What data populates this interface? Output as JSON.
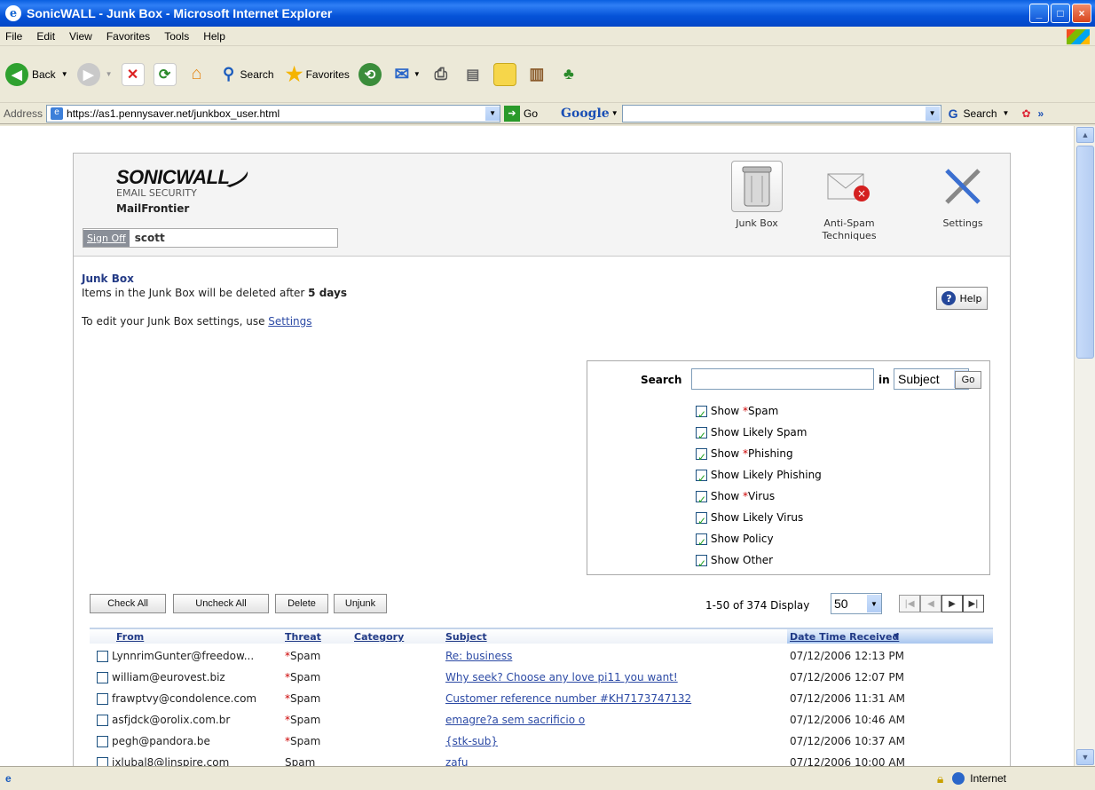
{
  "window": {
    "title": "SonicWALL - Junk Box - Microsoft Internet Explorer",
    "min": "_",
    "max": "□",
    "close": "×"
  },
  "menu": [
    "File",
    "Edit",
    "View",
    "Favorites",
    "Tools",
    "Help"
  ],
  "toolbar": {
    "back": "Back",
    "search": "Search",
    "favorites": "Favorites"
  },
  "address": {
    "label": "Address",
    "url": "https://as1.pennysaver.net/junkbox_user.html",
    "go": "Go",
    "google": "Google",
    "google_search": "Search"
  },
  "header": {
    "brand": "SONICWALL",
    "brand_sub": "EMAIL SECURITY",
    "brand_sub2": "MailFrontier",
    "signoff": "Sign Off",
    "user": "scott",
    "nav": [
      {
        "label": "Junk Box"
      },
      {
        "label": "Anti-Spam Techniques"
      },
      {
        "label": "Settings"
      }
    ]
  },
  "junkbox": {
    "title": "Junk Box",
    "desc_pre": "Items in the Junk Box will be deleted after ",
    "days": "5 days",
    "edit_pre": "To edit your Junk Box settings, use ",
    "edit_link": "Settings",
    "help": "Help"
  },
  "search": {
    "label": "Search",
    "in": "in",
    "field": "Subject",
    "go": "Go",
    "filters": [
      {
        "pre": "Show ",
        "star": "*",
        "name": "Spam"
      },
      {
        "pre": "Show Likely Spam",
        "star": "",
        "name": ""
      },
      {
        "pre": "Show ",
        "star": "*",
        "name": "Phishing"
      },
      {
        "pre": "Show Likely Phishing",
        "star": "",
        "name": ""
      },
      {
        "pre": "Show ",
        "star": "*",
        "name": "Virus"
      },
      {
        "pre": "Show Likely Virus",
        "star": "",
        "name": ""
      },
      {
        "pre": "Show Policy",
        "star": "",
        "name": ""
      },
      {
        "pre": "Show Other",
        "star": "",
        "name": ""
      }
    ]
  },
  "actions": {
    "check_all": "Check All",
    "uncheck_all": "Uncheck All",
    "delete": "Delete",
    "unjunk": "Unjunk"
  },
  "paging": {
    "summary": "1-50 of 374 Display",
    "per_page": "50"
  },
  "table": {
    "headers": {
      "from": "From",
      "threat": "Threat",
      "category": "Category",
      "subject": "Subject",
      "date": "Date Time Received"
    },
    "rows": [
      {
        "from": "LynnrimGunter@freedow...",
        "star": "*",
        "threat": "Spam",
        "subject": "Re: business",
        "date": "07/12/2006 12:13 PM"
      },
      {
        "from": "william@eurovest.biz",
        "star": "*",
        "threat": "Spam",
        "subject": "Why seek? Choose any love pi11 you want!",
        "date": "07/12/2006 12:07 PM"
      },
      {
        "from": "frawptvy@condolence.com",
        "star": "*",
        "threat": "Spam",
        "subject": "Customer reference number #KH7173747132",
        "date": "07/12/2006 11:31 AM"
      },
      {
        "from": "asfjdck@orolix.com.br",
        "star": "*",
        "threat": "Spam",
        "subject": "emagre?a sem sacrificio o",
        "date": "07/12/2006 10:46 AM"
      },
      {
        "from": "pegh@pandora.be",
        "star": "*",
        "threat": "Spam",
        "subject": "{stk-sub}",
        "date": "07/12/2006 10:37 AM"
      },
      {
        "from": "jxlubal8@linspire.com",
        "star": "",
        "threat": "Spam",
        "subject": "zafu",
        "date": "07/12/2006 10:00 AM"
      }
    ]
  },
  "status": {
    "zone": "Internet"
  }
}
